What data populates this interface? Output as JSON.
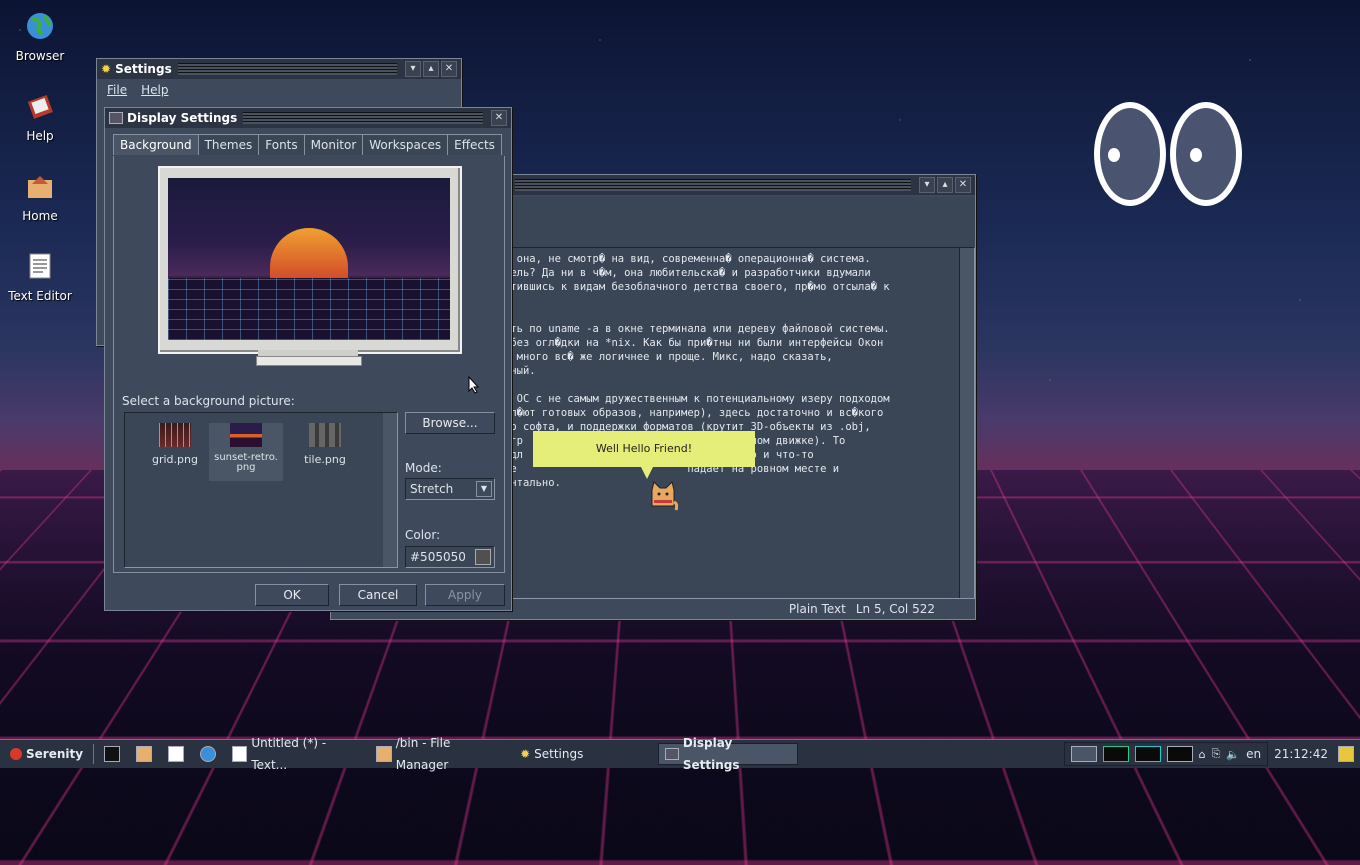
{
  "desktop_icons": [
    {
      "label": "Browser"
    },
    {
      "label": "Help"
    },
    {
      "label": "Home"
    },
    {
      "label": "Text Editor"
    }
  ],
  "settings_window": {
    "title": "Settings",
    "menu": {
      "file": "File",
      "help": "Help"
    }
  },
  "display_window": {
    "title": "Display Settings",
    "tabs": [
      "Background",
      "Themes",
      "Fonts",
      "Monitor",
      "Workspaces",
      "Effects"
    ],
    "active_tab": "Background",
    "select_label": "Select a background picture:",
    "pictures": [
      {
        "name": "grid.png"
      },
      {
        "name": "sunset-retro.png"
      },
      {
        "name": "tile.png"
      }
    ],
    "browse_label": "Browse...",
    "mode_label": "Mode:",
    "mode_value": "Stretch",
    "color_label": "Color:",
    "color_value": "#505050",
    "ok_label": "OK",
    "cancel_label": "Cancel",
    "apply_label": "Apply"
  },
  "text_editor": {
    "lines": [
      "и она, не смотр� на вид, современна� операционна� система.",
      "цель? Да ни в ч�м, она любительска� и разработчики вдумали",
      "атившись к видам безоблачного детства своего, пр�мо отсыла� к",
      "",
      "",
      "еть по uname -a в окне терминала или дереву файловой системы.",
      " без огл�дки на *nix. Как бы при�тны ни были интерфейсы Окон",
      "о много вс� же логичнее и проще. Микс, надо сказать,",
      "тный.",
      "",
      "� ОС с не самым дружественным к потенциальному изеру подходом",
      "вл�ют готовых образов, например), здесь достаточно и вс�кого",
      "го софта, и поддержки форматов (крутит 3D-объекты из .obj,",
      " гр                          а собственном движке). То",
      " дл                          скалось, но и что-то",
      "ие                           падает на ровном месте и",
      "ентально."
    ],
    "status_mode": "Plain Text",
    "status_pos": "Ln 5, Col 522"
  },
  "assistant": {
    "bubble": "Well Hello Friend!"
  },
  "taskbar": {
    "start": "Serenity",
    "windows": [
      {
        "label": "Untitled (*) - Text..."
      },
      {
        "label": "/bin - File Manager"
      },
      {
        "label": "Settings"
      },
      {
        "label": "Display Settings"
      }
    ],
    "lang": "en",
    "clock": "21:12:42"
  },
  "colors": {
    "accent": "#e6ee7a",
    "window_bg": "#3e4a5c",
    "color_swatch": "#505050"
  }
}
